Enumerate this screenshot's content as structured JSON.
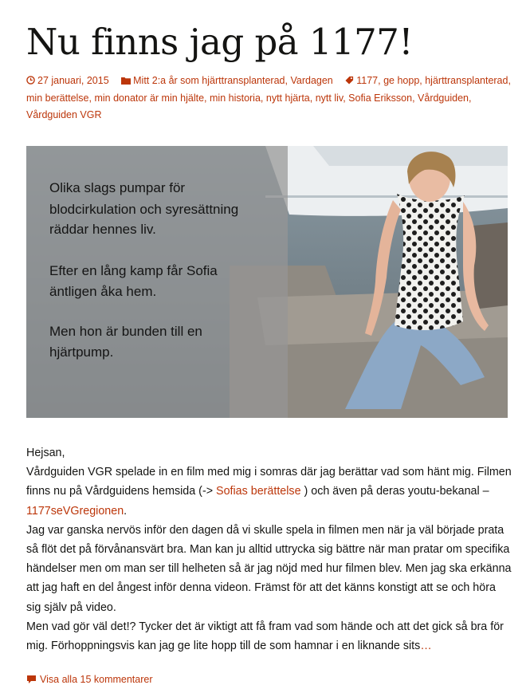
{
  "post": {
    "title": "Nu finns jag på 1177!",
    "date": "27 januari, 2015",
    "categories": [
      "Mitt 2:a år som hjärttransplanterad",
      "Vardagen"
    ],
    "tags": [
      "1177",
      "ge hopp",
      "hjärttransplanterad",
      "min berättelse",
      "min donator är min hjälte",
      "min historia",
      "nytt hjärta",
      "nytt liv",
      "Sofia Eriksson",
      "Vårdguiden",
      "Vårdguiden VGR"
    ]
  },
  "image": {
    "caption_1": "Olika slags pumpar för",
    "caption_2": "blodcirkulation och syresättning",
    "caption_3": "räddar hennes liv.",
    "caption_4": "Efter en lång kamp får Sofia",
    "caption_5": "äntligen åka hem.",
    "caption_6": "Men hon är bunden till en",
    "caption_7": "hjärtpump."
  },
  "content": {
    "greeting": "Hejsan,",
    "p1_a": "Vårdguiden VGR spelade in en film med mig i somras där jag berättar vad som hänt mig. Filmen finns nu på Vårdguidens hemsida (-> ",
    "p1_link1": "Sofias berättelse",
    "p1_b": " ) och även på deras youtu-bekanal – ",
    "p1_link2": "1177seVGregionen",
    "p1_c": ".",
    "p2": "Jag var ganska nervös inför den dagen då vi skulle spela in filmen men när ja väl började prata så flöt det på förvånansvärt bra. Man kan ju alltid uttrycka sig bättre när man pratar om specifika händelser men om man ser till helheten så är jag nöjd med hur filmen blev. Men jag ska erkänna att jag haft en del ångest inför denna videon. Främst för att det känns konstigt att se och höra sig själv på video.",
    "p3": "Men vad gör väl det!? Tycker det är viktigt att få fram vad som hände och att det gick så bra för mig. Förhoppningsvis kan jag ge lite hopp till de som hamnar i en liknande sits",
    "more": "…"
  },
  "comments_link": "Visa alla 15 kommentarer",
  "colors": {
    "accent": "#bc360a",
    "text": "#141412"
  },
  "icons": [
    "clock-icon",
    "folder-icon",
    "tag-icon",
    "comment-icon"
  ]
}
